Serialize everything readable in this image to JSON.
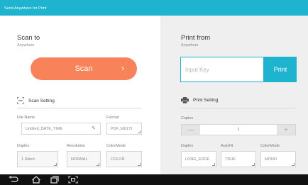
{
  "app": {
    "title": "Send Anywhere for Print"
  },
  "scan": {
    "title": "Scan to",
    "subtitle": "Anywhere",
    "button_label": "Scan",
    "setting_title": "Scan Setting",
    "file_name_label": "File Name",
    "file_name_value": "Untitled_DATE_TIME",
    "format_label": "Format",
    "format_value": "PDF_MULTI",
    "duplex_label": "Duplex",
    "duplex_value": "1 Sided",
    "resolution_label": "Resolution",
    "resolution_value": "NORMAL",
    "colormode_label": "ColorMode",
    "colormode_value": "COLOR"
  },
  "print": {
    "title": "Print from",
    "subtitle": "Anywhere",
    "key_placeholder": "Input Key",
    "button_label": "Print",
    "setting_title": "Print Setting",
    "copies_label": "Copies",
    "copies_value": "1",
    "minus_symbol": "—",
    "plus_symbol": "+",
    "duplex_label": "Duplex",
    "duplex_value": "LONG_EDGE",
    "autofit_label": "AutoFit",
    "autofit_value": "TRUE",
    "colormode_label": "ColorMode",
    "colormode_value": "MONO"
  },
  "navbar": {
    "icons": [
      "back-icon",
      "home-icon",
      "recent-apps-icon",
      "screenshot-icon"
    ]
  },
  "colors": {
    "accent": "#1eb3cf",
    "scan_button": "#f8835a",
    "right_panel_bg": "#efefef",
    "navbar_bg": "#111111"
  }
}
